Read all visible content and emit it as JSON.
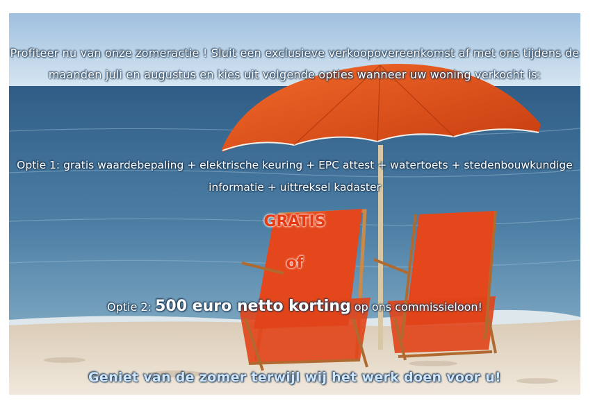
{
  "promo": {
    "intro": "Profiteer nu van onze zomeractie ! Sluit een exclusieve verkoopovereenkomst af met ons tijdens de maanden juli en augustus en kies uit volgende opties wanneer uw woning verkocht is:",
    "option1": "Optie 1: gratis waardebepaling + elektrische keuring + EPC attest + watertoets + stedenbouwkundige informatie + uittreksel kadaster",
    "gratis": "GRATIS",
    "or": "of",
    "option2_prefix": "Optie 2:",
    "option2_highlight": "500 euro netto korting",
    "option2_suffix": "op ons commissieloon!",
    "closing": "Geniet van de zomer terwijl wij het werk doen voor u!"
  },
  "colors": {
    "sky": "#b9d2e8",
    "sea": "#3f6f95",
    "sand": "#e8dccb",
    "umbrella": "#e8531b",
    "chair": "#e5471c",
    "accent_text": "#e63a12"
  }
}
